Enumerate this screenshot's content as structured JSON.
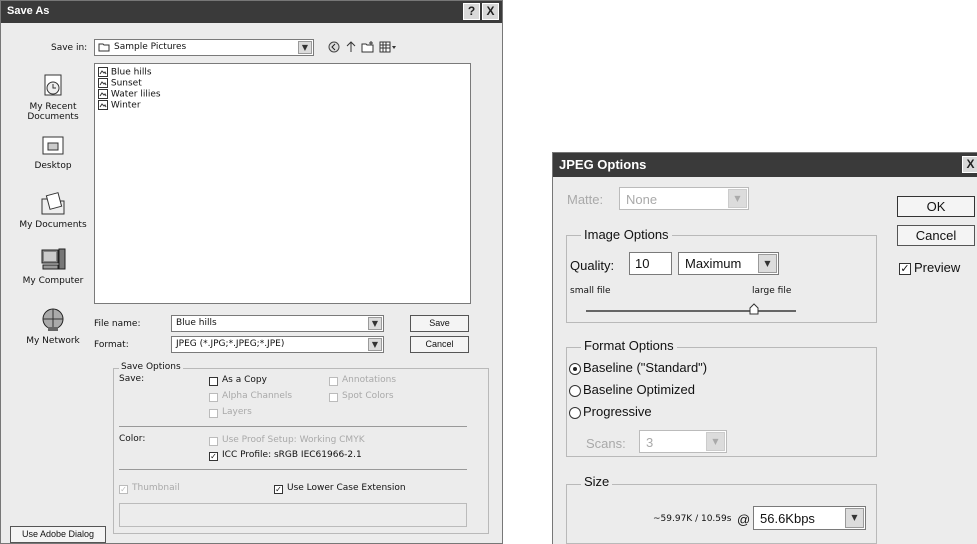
{
  "save_as": {
    "title": "Save As",
    "save_in_label": "Save in:",
    "save_in_value": "Sample Pictures",
    "places": [
      {
        "label": "My Recent\nDocuments",
        "icon": "recent-documents-icon"
      },
      {
        "label": "Desktop",
        "icon": "desktop-icon"
      },
      {
        "label": "My Documents",
        "icon": "my-documents-icon"
      },
      {
        "label": "My Computer",
        "icon": "my-computer-icon"
      },
      {
        "label": "My Network",
        "icon": "my-network-icon"
      }
    ],
    "files": [
      "Blue hills",
      "Sunset",
      "Water lilies",
      "Winter"
    ],
    "file_name_label": "File name:",
    "file_name_value": "Blue hills",
    "format_label": "Format:",
    "format_value": "JPEG (*.JPG;*.JPEG;*.JPE)",
    "save_button": "Save",
    "cancel_button": "Cancel",
    "save_options_legend": "Save Options",
    "save_label": "Save:",
    "as_a_copy": "As a Copy",
    "annotations": "Annotations",
    "alpha_channels": "Alpha Channels",
    "spot_colors": "Spot Colors",
    "layers": "Layers",
    "color_label": "Color:",
    "use_proof_setup": "Use Proof Setup:  Working CMYK",
    "icc_profile": "ICC Profile:  sRGB IEC61966-2.1",
    "thumbnail": "Thumbnail",
    "use_lower_case": "Use Lower Case Extension",
    "use_adobe_dialog": "Use Adobe Dialog"
  },
  "jpeg": {
    "title": "JPEG Options",
    "matte_label": "Matte:",
    "matte_value": "None",
    "image_options_legend": "Image Options",
    "quality_label": "Quality:",
    "quality_value": "10",
    "quality_preset": "Maximum",
    "small_file": "small file",
    "large_file": "large file",
    "quality_slider_fraction": 0.8,
    "format_options_legend": "Format Options",
    "baseline_standard": "Baseline (\"Standard\")",
    "baseline_optimized": "Baseline Optimized",
    "progressive": "Progressive",
    "scans_label": "Scans:",
    "scans_value": "3",
    "size_legend": "Size",
    "size_value": "~59.97K / 10.59s",
    "at": "@",
    "speed_value": "56.6Kbps",
    "ok_button": "OK",
    "cancel_button": "Cancel",
    "preview_label": "Preview"
  },
  "icons": {
    "help": "?",
    "close": "X",
    "dropdown": "▼",
    "check": "✓"
  }
}
